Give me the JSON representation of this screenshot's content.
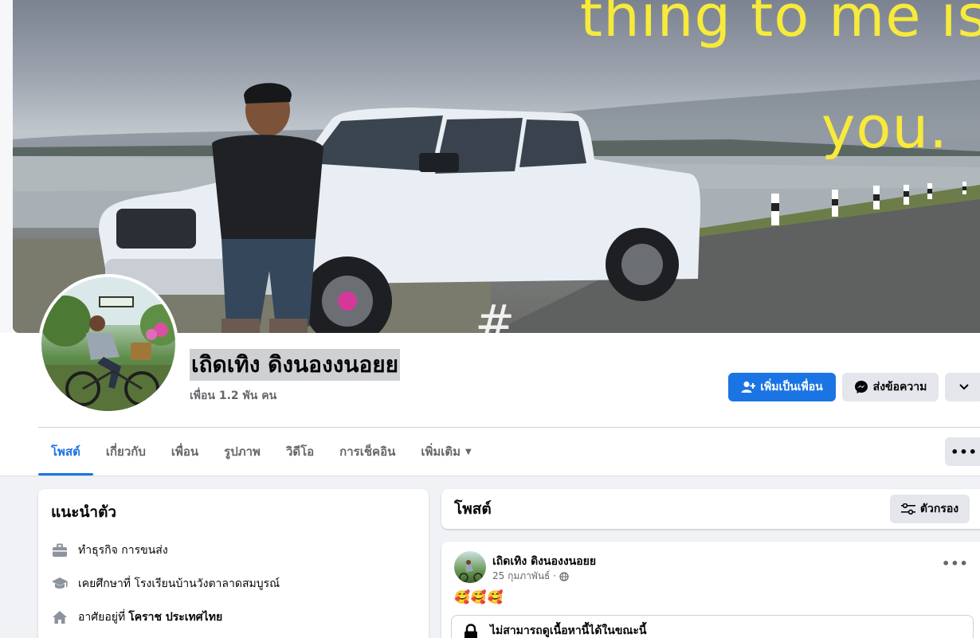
{
  "cover": {
    "text_line1": "thing to me is",
    "text_line2": "you."
  },
  "profile": {
    "name": "เถิดเทิง ดิงนองงนอยย",
    "friends_count": "เพื่อน 1.2 พัน คน"
  },
  "actions": {
    "add_friend_label": "เพิ่มเป็นเพื่อน",
    "message_label": "ส่งข้อความ"
  },
  "tabs": [
    {
      "label": "โพสต์",
      "active": true
    },
    {
      "label": "เกี่ยวกับ"
    },
    {
      "label": "เพื่อน"
    },
    {
      "label": "รูปภาพ"
    },
    {
      "label": "วิดีโอ"
    },
    {
      "label": "การเช็คอิน"
    },
    {
      "label": "เพิ่มเติม"
    }
  ],
  "intro": {
    "title": "แนะนำตัว",
    "rows": [
      {
        "icon": "briefcase-icon",
        "text": "ทำธุรกิจ การขนส่ง",
        "bold": ""
      },
      {
        "icon": "graduation-cap-icon",
        "text": "เคยศึกษาที่ โรงเรียนบ้านวังตาลาดสมบูรณ์",
        "bold": ""
      },
      {
        "icon": "home-icon",
        "text": "อาศัยอยู่ที่",
        "bold": "โคราช ประเทศไทย"
      }
    ]
  },
  "posts": {
    "title": "โพสต์",
    "filter_label": "ตัวกรอง",
    "items": [
      {
        "author": "เถิดเทิง ดิงนองงนอยย",
        "date": "25 กุมภาพันธ์ ·",
        "emoji": "🥰🥰🥰",
        "locked_text": "ไม่สามารถดูเนื้อหานี้ได้ในขณะนี้"
      }
    ]
  },
  "colors": {
    "accent": "#1b74e4",
    "cover_text": "#f7ea3a"
  }
}
